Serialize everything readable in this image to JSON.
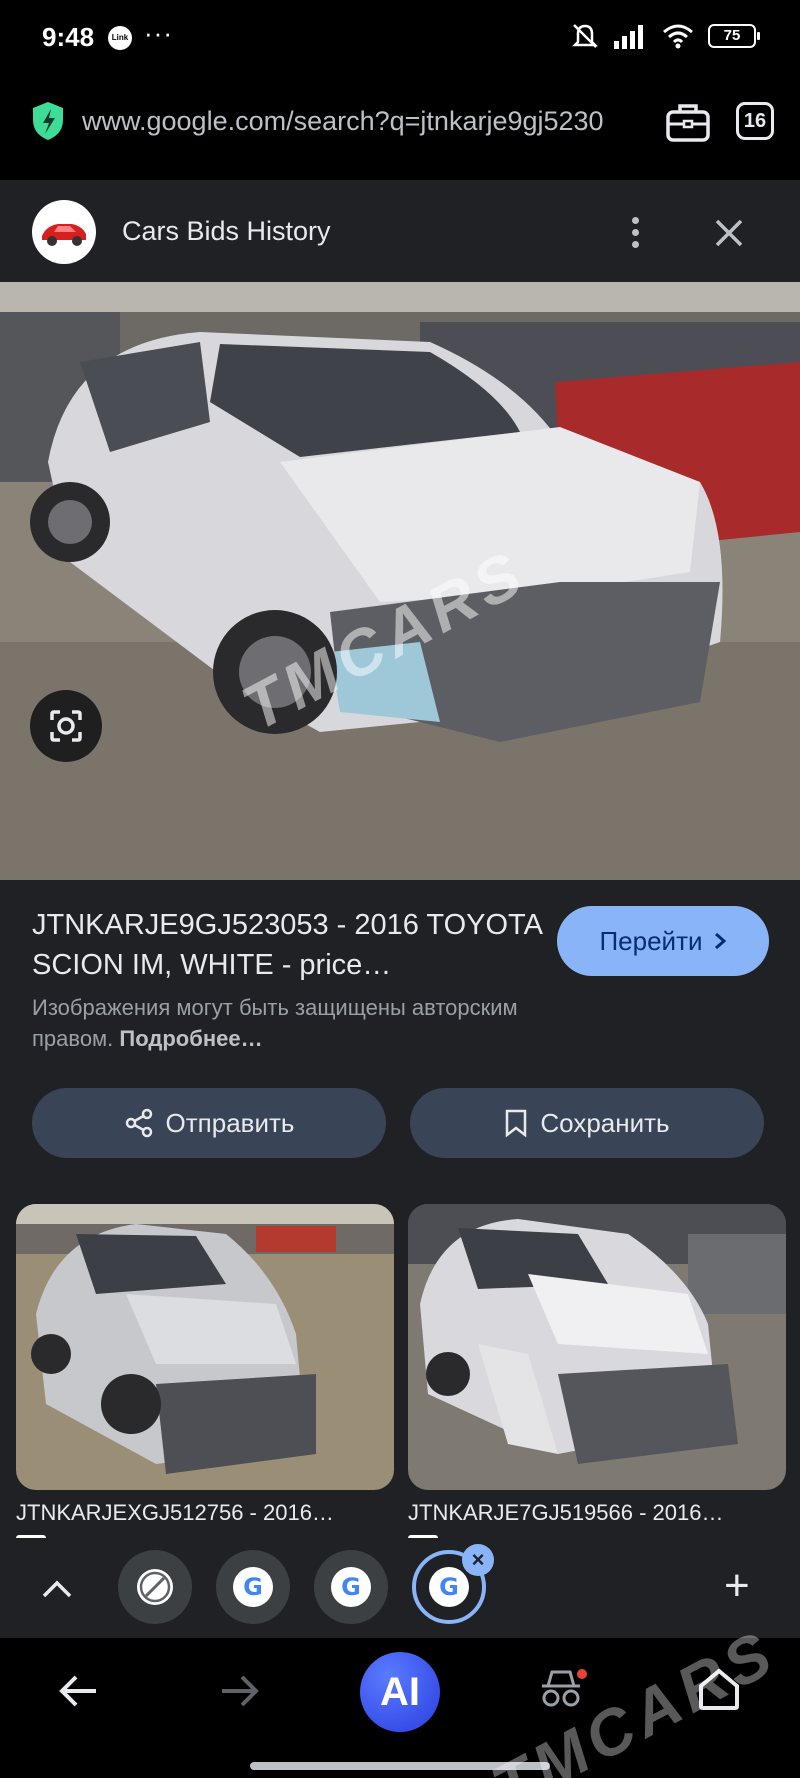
{
  "status_bar": {
    "time": "9:48",
    "link_badge": "Link",
    "dots": "···",
    "battery": "75"
  },
  "browser": {
    "url": "www.google.com/search?q=jtnkarje9gj5230",
    "tab_count": "16"
  },
  "panel": {
    "site_title": "Cars Bids History",
    "result_title": "JTNKARJE9GJ523053 - 2016 TOYOTA SCION IM, WHITE - price…",
    "goto_label": "Перейти",
    "copyright_text": "Изображения могут быть защищены авторским правом.",
    "copyright_more": "Подробнее…",
    "share_label": "Отправить",
    "save_label": "Сохранить",
    "related": [
      {
        "caption": "JTNKARJEXGJ512756 - 2016…"
      },
      {
        "caption": "JTNKARJE7GJ519566 - 2016…"
      }
    ]
  },
  "nav": {
    "ai_label": "AI"
  },
  "watermark": "TMCARS",
  "colors": {
    "accent": "#8ab4f8",
    "panel_bg": "#202124",
    "button_bg": "#394457"
  }
}
